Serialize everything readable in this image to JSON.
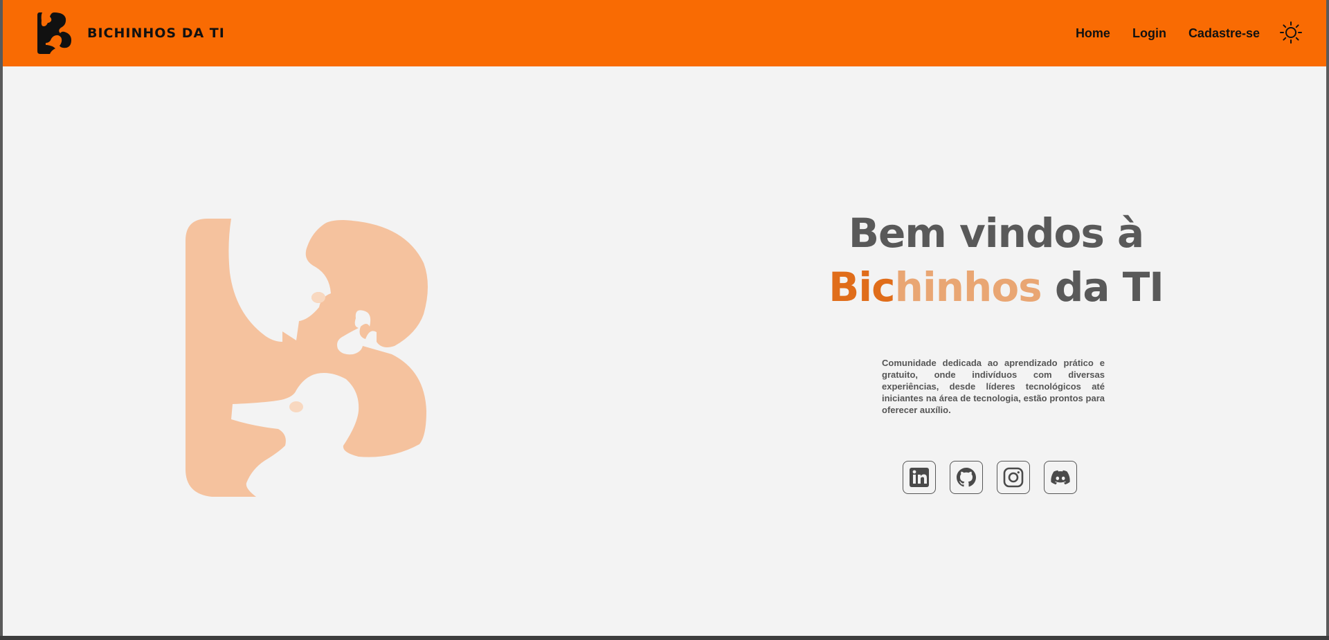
{
  "header": {
    "brand_name": "BICHINHOS DA TI",
    "nav": [
      {
        "label": "Home"
      },
      {
        "label": "Login"
      },
      {
        "label": "Cadastre-se"
      }
    ],
    "theme_icon": "sun-icon"
  },
  "hero": {
    "title_line1": "Bem vindos à",
    "title_part_a": "Bic",
    "title_part_b": "hinhos",
    "title_part_c": " da TI",
    "description": "Comunidade dedicada ao aprendizado prático e gratuito, onde indivíduos com diversas experiências, desde líderes tecnológicos até iniciantes na área de tecnologia, estão prontos para oferecer auxílio."
  },
  "social": [
    {
      "name": "linkedin",
      "icon": "linkedin-icon"
    },
    {
      "name": "github",
      "icon": "github-icon"
    },
    {
      "name": "instagram",
      "icon": "instagram-icon"
    },
    {
      "name": "discord",
      "icon": "discord-icon"
    }
  ],
  "colors": {
    "header_bg": "#f96b03",
    "page_bg": "#f3f3f3",
    "logo_tint": "#f5c29e",
    "title_text": "#595959",
    "accent_dark": "#e06d1a",
    "accent_light": "#e9a673"
  }
}
